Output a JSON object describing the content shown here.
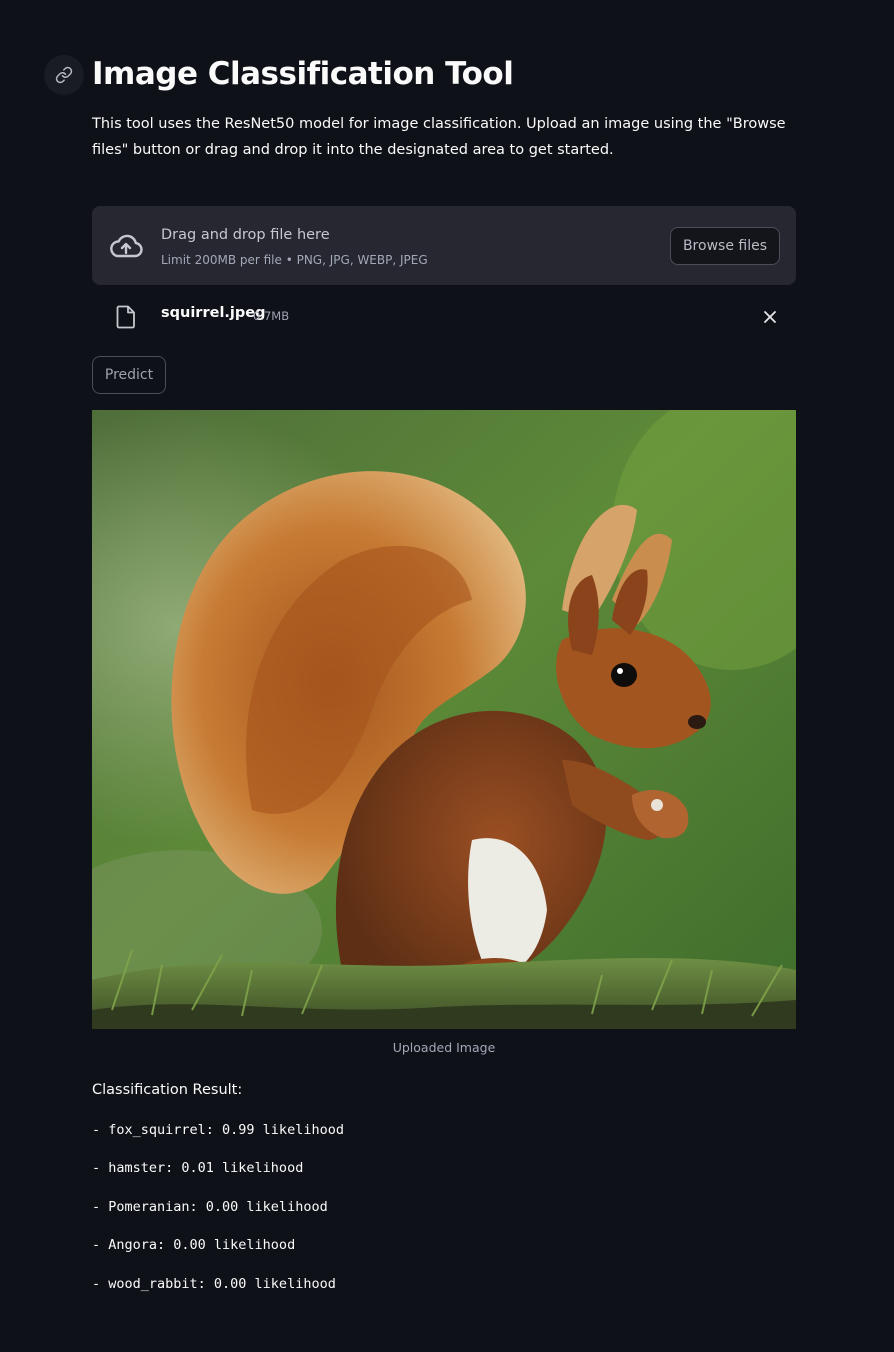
{
  "header": {
    "title": "Image Classification Tool",
    "description": "This tool uses the ResNet50 model for image classification. Upload an image using the \"Browse files\" button or drag and drop it into the designated area to get started."
  },
  "uploader": {
    "drop_text": "Drag and drop file here",
    "limit_text": "Limit 200MB per file • PNG, JPG, WEBP, JPEG",
    "browse_label": "Browse files",
    "file": {
      "name": "squirrel.jpeg",
      "size": "0.7MB"
    }
  },
  "predict_label": "Predict",
  "image": {
    "caption": "Uploaded Image"
  },
  "result": {
    "heading": "Classification Result:",
    "items": [
      "- fox_squirrel: 0.99 likelihood",
      "- hamster: 0.01 likelihood",
      "- Pomeranian: 0.00 likelihood",
      "- Angora: 0.00 likelihood",
      "- wood_rabbit: 0.00 likelihood"
    ]
  },
  "colors": {
    "background": "#0e1117",
    "dropzone": "#262730",
    "text": "#fafafa",
    "muted": "#a3a8b8"
  }
}
